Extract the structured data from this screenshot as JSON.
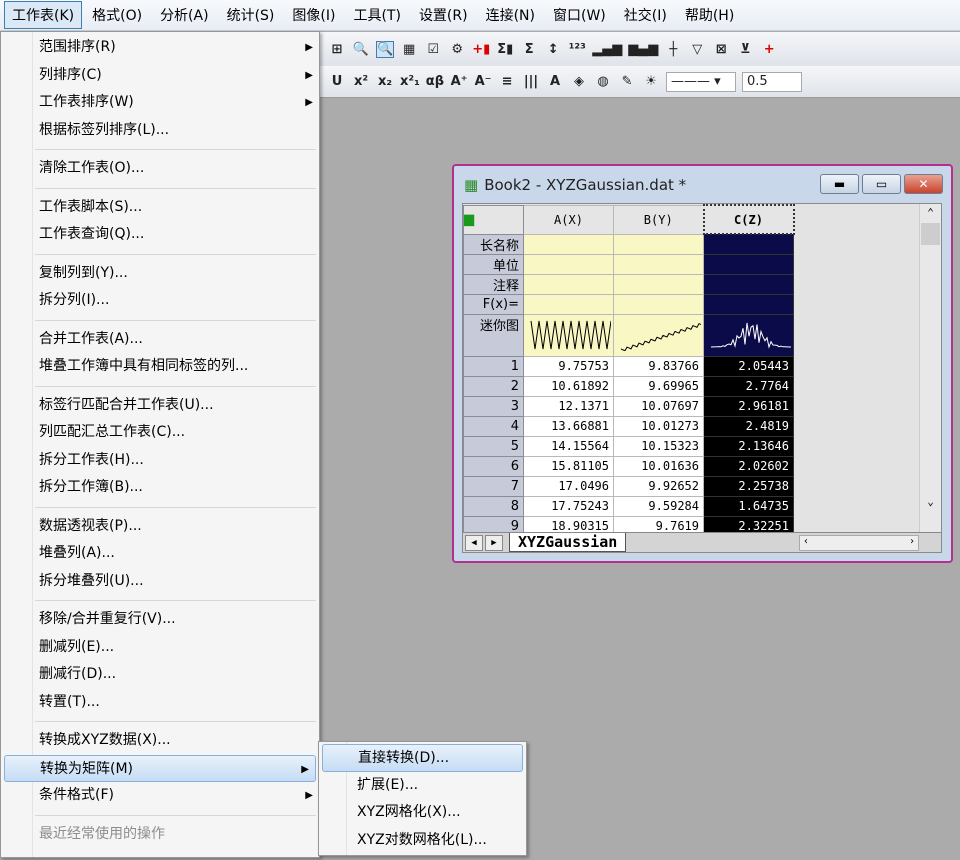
{
  "menubar": [
    "工作表(K)",
    "格式(O)",
    "分析(A)",
    "统计(S)",
    "图像(I)",
    "工具(T)",
    "设置(R)",
    "连接(N)",
    "窗口(W)",
    "社交(I)",
    "帮助(H)"
  ],
  "toolbar": {
    "icons1": [
      "structure-icon",
      "zoom-icon",
      "zoom-active-icon",
      "worksheet-icon",
      "script-icon",
      "gear-icon",
      "add-column-icon",
      "sum-icon",
      "column-sum-icon",
      "sort-icon",
      "set-values-icon",
      "bar-chart-icon",
      "grouped-bar-icon",
      "floating-bar-icon",
      "filter-icon",
      "clear-filter-icon",
      "reapply-filter-icon"
    ],
    "glyphs1": [
      "⊞",
      "🔍",
      "🔍",
      "▦",
      "☑",
      "⚙",
      "+▮",
      "Σ▮",
      "Σ",
      "↕",
      "¹²³",
      "▂▄▆",
      "▆▄▆",
      "┼",
      "▽",
      "⊠",
      "⊻",
      "+"
    ],
    "glyphs2": [
      "U",
      "x²",
      "x₂",
      "x²₁",
      "αβ",
      "A⁺",
      "A⁻",
      "≡",
      "|||",
      "A",
      "◈",
      "◍",
      "✎",
      "☀"
    ],
    "line_width": "0.5"
  },
  "menu": {
    "items": [
      {
        "label": "范围排序(R)",
        "submenu": true
      },
      {
        "label": "列排序(C)",
        "submenu": true
      },
      {
        "label": "工作表排序(W)",
        "submenu": true
      },
      {
        "label": "根据标签列排序(L)..."
      },
      {
        "sep": true
      },
      {
        "label": "清除工作表(O)..."
      },
      {
        "sep": true
      },
      {
        "label": "工作表脚本(S)..."
      },
      {
        "label": "工作表查询(Q)..."
      },
      {
        "sep": true
      },
      {
        "label": "复制列到(Y)..."
      },
      {
        "label": "拆分列(I)..."
      },
      {
        "sep": true
      },
      {
        "label": "合并工作表(A)..."
      },
      {
        "label": "堆叠工作簿中具有相同标签的列..."
      },
      {
        "sep": true
      },
      {
        "label": "标签行匹配合并工作表(U)..."
      },
      {
        "label": "列匹配汇总工作表(C)..."
      },
      {
        "label": "拆分工作表(H)..."
      },
      {
        "label": "拆分工作簿(B)..."
      },
      {
        "sep": true
      },
      {
        "label": "数据透视表(P)..."
      },
      {
        "label": "堆叠列(A)..."
      },
      {
        "label": "拆分堆叠列(U)..."
      },
      {
        "sep": true
      },
      {
        "label": "移除/合并重复行(V)..."
      },
      {
        "label": "删减列(E)..."
      },
      {
        "label": "删减行(D)..."
      },
      {
        "label": "转置(T)..."
      },
      {
        "sep": true
      },
      {
        "label": "转换成XYZ数据(X)..."
      },
      {
        "label": "转换为矩阵(M)",
        "submenu": true,
        "highlighted": true
      },
      {
        "label": "条件格式(F)",
        "submenu": true
      },
      {
        "sep": true
      },
      {
        "label": "最近经常使用的操作",
        "disabled": true
      }
    ],
    "submenu": [
      {
        "label": "直接转换(D)...",
        "highlighted": true
      },
      {
        "label": "扩展(E)..."
      },
      {
        "label": "XYZ网格化(X)..."
      },
      {
        "label": "XYZ对数网格化(L)..."
      }
    ]
  },
  "workbook": {
    "title": "Book2 - XYZGaussian.dat *",
    "columns": [
      "A(X)",
      "B(Y)",
      "C(Z)"
    ],
    "label_rows": [
      "长名称",
      "单位",
      "注释",
      "F(x)=",
      "迷你图"
    ],
    "rows": [
      [
        "1",
        "9.75753",
        "9.83766",
        "2.05443"
      ],
      [
        "2",
        "10.61892",
        "9.69965",
        "2.7764"
      ],
      [
        "3",
        "12.1371",
        "10.07697",
        "2.96181"
      ],
      [
        "4",
        "13.66881",
        "10.01273",
        "2.4819"
      ],
      [
        "5",
        "14.15564",
        "10.15323",
        "2.13646"
      ],
      [
        "6",
        "15.81105",
        "10.01636",
        "2.02602"
      ],
      [
        "7",
        "17.0496",
        "9.92652",
        "2.25738"
      ],
      [
        "8",
        "17.75243",
        "9.59284",
        "1.64735"
      ],
      [
        "9",
        "18.90315",
        "9.7619",
        "2.32251"
      ]
    ],
    "sheet_tab": "XYZGaussian"
  },
  "colors": {
    "accent_border": "#b3308f",
    "selected_column": "#000000",
    "label_fill": "#f9f8c4"
  }
}
